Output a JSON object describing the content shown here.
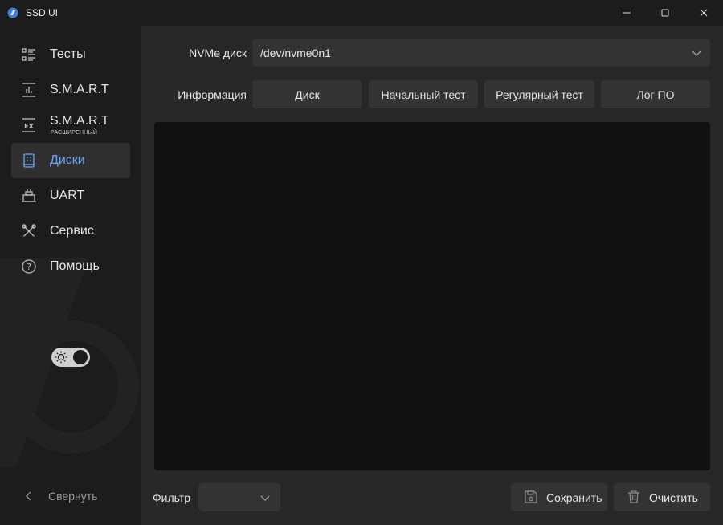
{
  "window": {
    "title": "SSD UI",
    "controls": [
      "minimize",
      "maximize",
      "close"
    ]
  },
  "sidebar": {
    "items": [
      {
        "label": "Тесты",
        "icon": "tests-list-icon",
        "active": false
      },
      {
        "label": "S.M.A.R.T",
        "icon": "chart-icon",
        "active": false
      },
      {
        "label": "S.M.A.R.T",
        "sublabel": "РАСШИРЕННЫЙ",
        "icon": "ex-icon",
        "active": false
      },
      {
        "label": "Диски",
        "icon": "disk-icon",
        "active": true
      },
      {
        "label": "UART",
        "icon": "uart-icon",
        "active": false
      },
      {
        "label": "Сервис",
        "icon": "tools-icon",
        "active": false
      },
      {
        "label": "Помощь",
        "icon": "help-icon",
        "active": false
      }
    ],
    "collapse_label": "Свернуть",
    "theme_toggle": "dark"
  },
  "main": {
    "device_label": "NVMe диск",
    "device_value": "/dev/nvme0n1",
    "info_label": "Информация",
    "tabs": [
      {
        "label": "Диск"
      },
      {
        "label": "Начальный тест"
      },
      {
        "label": "Регулярный тест"
      },
      {
        "label": "Лог ПО"
      }
    ],
    "filter_label": "Фильтр",
    "filter_value": "",
    "save_label": "Сохранить",
    "clear_label": "Очистить"
  },
  "colors": {
    "accent": "#6ba6f5",
    "sidebar_bg": "#1c1c1c",
    "main_bg": "#272727",
    "control_bg": "#333333",
    "log_bg": "#111111"
  }
}
